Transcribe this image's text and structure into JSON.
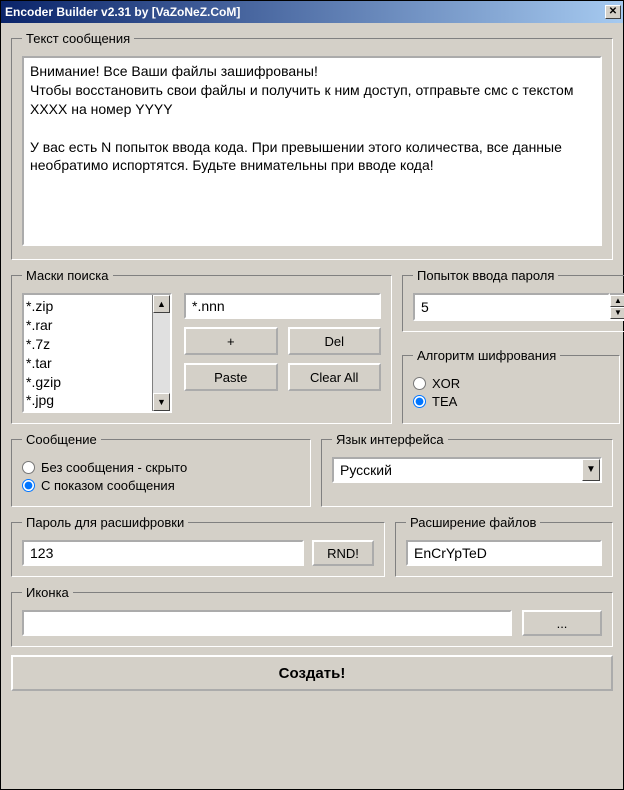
{
  "window": {
    "title": "Encoder Builder v2.31 by [VaZoNeZ.CoM]"
  },
  "groups": {
    "message_text": "Текст сообщения",
    "masks": "Маски поиска",
    "attempts": "Попыток ввода пароля",
    "algorithm": "Алгоритм шифрования",
    "message_mode": "Сообщение",
    "language": "Язык интерфейса",
    "password": "Пароль для расшифровки",
    "extension": "Расширение файлов",
    "icon": "Иконка"
  },
  "message": "Внимание! Все Ваши файлы зашифрованы!\nЧтобы восстановить свои файлы и получить к ним доступ, отправьте смс с текстом XXXX на номер YYYY\n\nУ вас есть N попыток ввода кода. При превышении этого количества, все данные необратимо испортятся. Будьте внимательны при вводе кода!",
  "masks": {
    "items": [
      "*.zip",
      "*.rar",
      "*.7z",
      "*.tar",
      "*.gzip",
      "*.jpg"
    ],
    "current": "*.nnn",
    "buttons": {
      "add": "+",
      "del": "Del",
      "paste": "Paste",
      "clear": "Clear All"
    }
  },
  "attempts": {
    "value": "5",
    "help": "?"
  },
  "algorithm": {
    "options": {
      "xor": "XOR",
      "tea": "TEA"
    },
    "selected": "tea"
  },
  "message_mode": {
    "hidden": "Без сообщения - скрыто",
    "shown": "С показом сообщения",
    "selected": "shown"
  },
  "language": {
    "value": "Русский"
  },
  "password": {
    "value": "123",
    "rnd": "RND!"
  },
  "extension": {
    "value": "EnCrYpTeD"
  },
  "icon": {
    "value": "",
    "browse": "..."
  },
  "create": "Создать!"
}
